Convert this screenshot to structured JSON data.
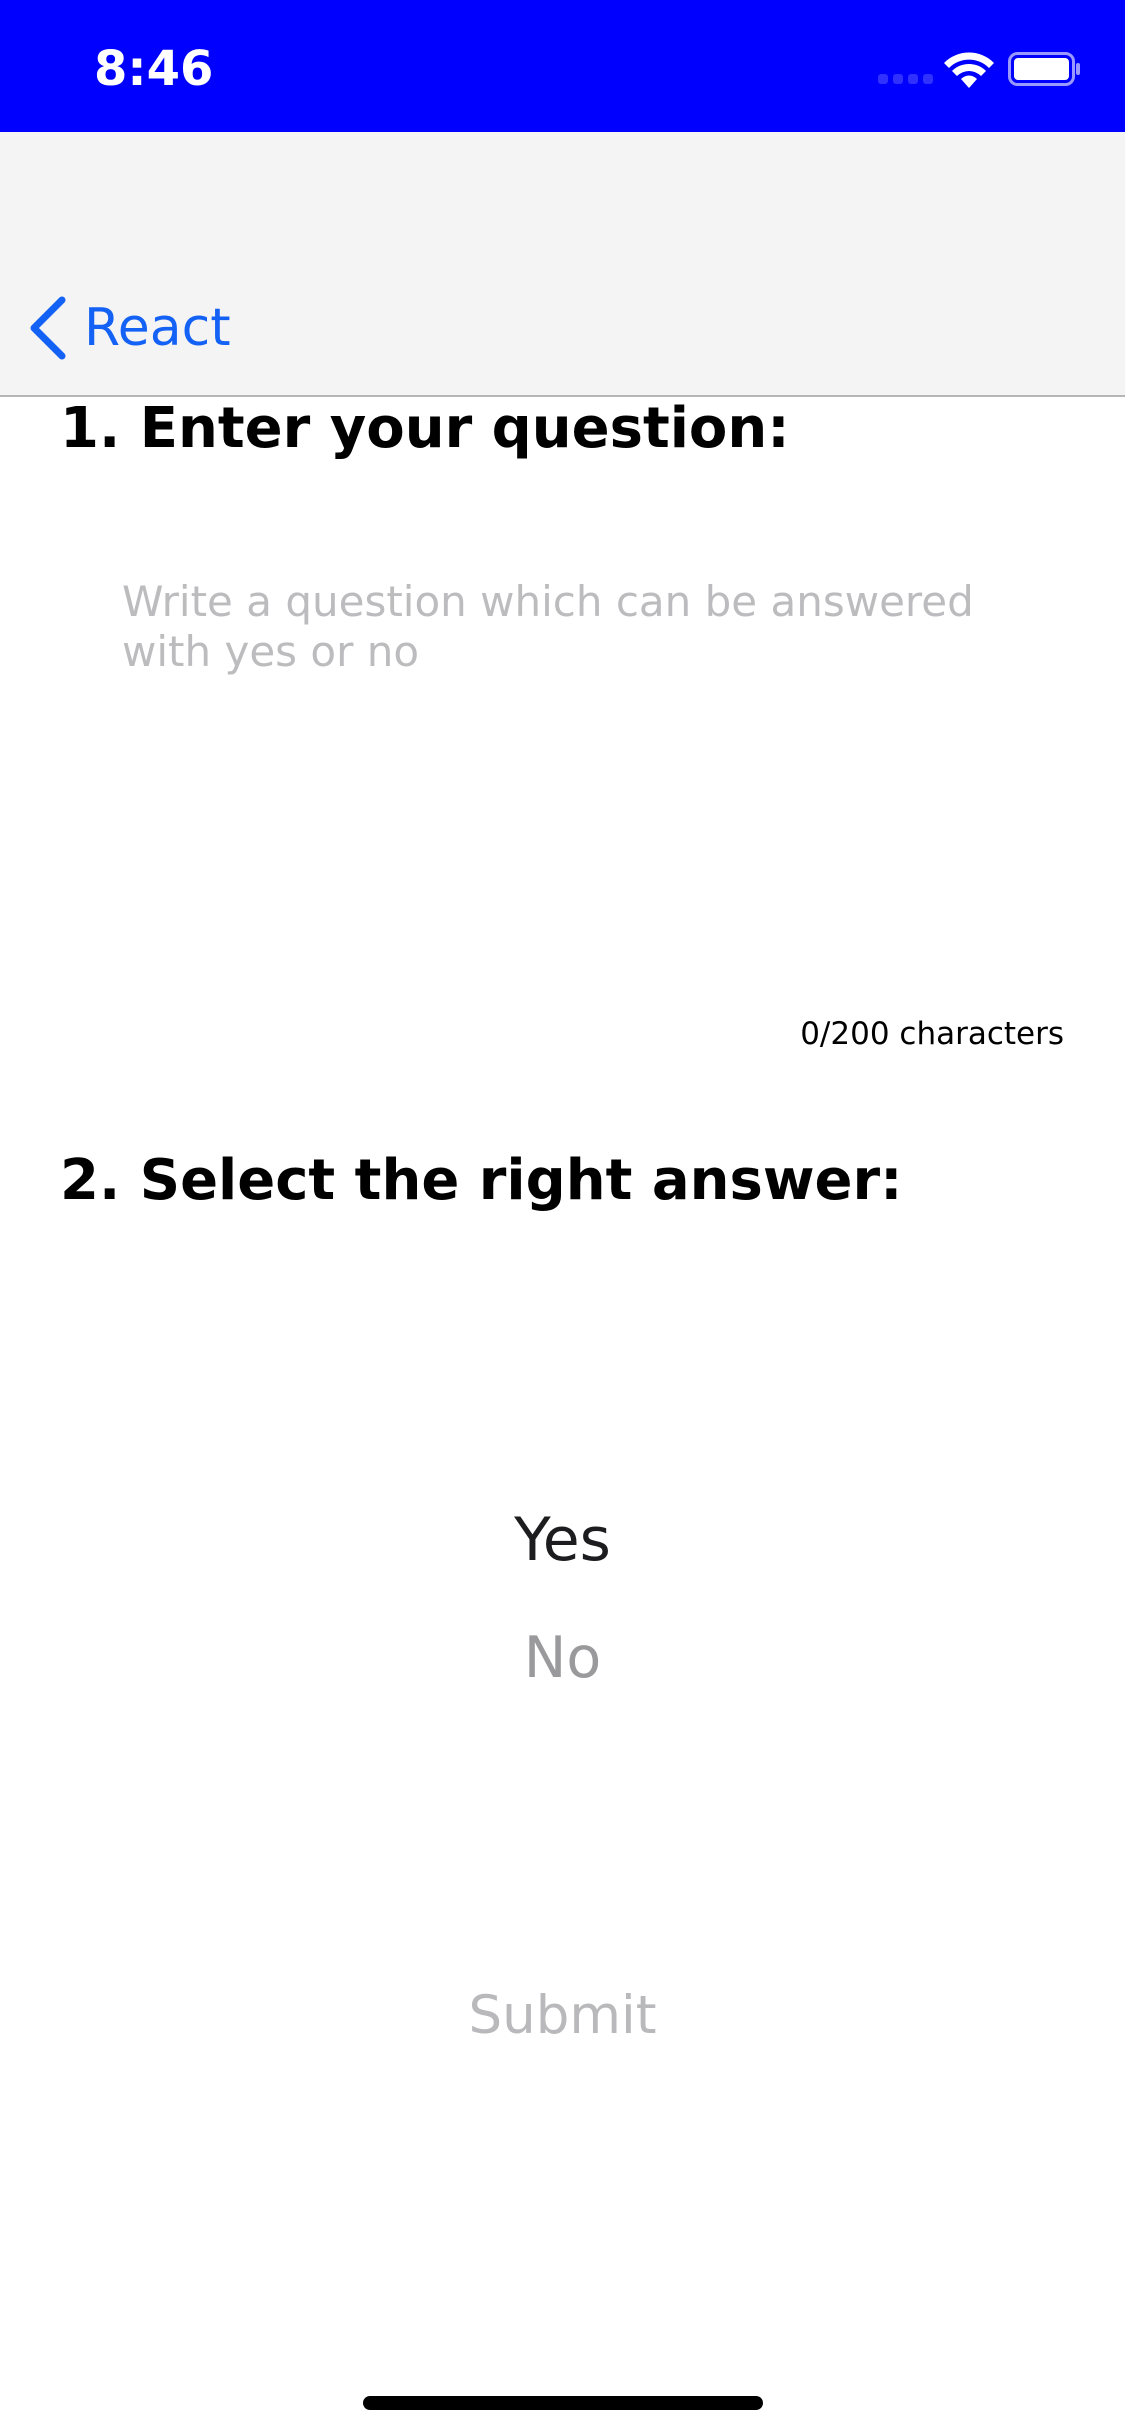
{
  "status_bar": {
    "time": "8:46",
    "background_color": "#0000ff",
    "icons": [
      "signal-icon",
      "wifi-icon",
      "battery-icon"
    ]
  },
  "nav": {
    "back_label": "React",
    "back_icon": "chevron-left-icon",
    "accent_color": "#1462f5"
  },
  "question_section": {
    "heading": "1. Enter your question:",
    "input_placeholder": "Write a question which can be answered with yes or no",
    "input_value": "",
    "char_counter": "0/200 characters"
  },
  "answer_section": {
    "heading": "2. Select the right answer:",
    "options": [
      "Yes",
      "No"
    ],
    "selected": "Yes"
  },
  "submit": {
    "label": "Submit",
    "enabled": false
  }
}
